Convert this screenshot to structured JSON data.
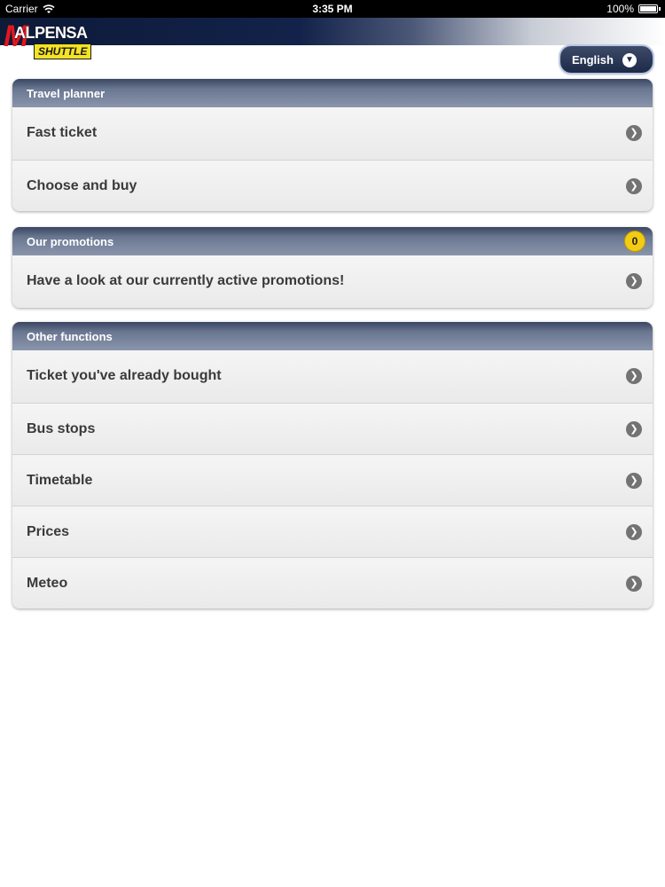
{
  "statusbar": {
    "carrier": "Carrier",
    "time": "3:35 PM",
    "battery": "100%"
  },
  "header": {
    "logo_text": "MALPENSA SHUTTLE"
  },
  "language": {
    "selected": "English"
  },
  "groups": [
    {
      "title": "Travel planner",
      "items": [
        {
          "label": "Fast ticket"
        },
        {
          "label": "Choose and buy"
        }
      ]
    },
    {
      "title": "Our promotions",
      "badge": "0",
      "items": [
        {
          "label": "Have a look at our currently active promotions!"
        }
      ]
    },
    {
      "title": "Other functions",
      "items": [
        {
          "label": "Ticket you've already bought"
        },
        {
          "label": "Bus stops"
        },
        {
          "label": "Timetable"
        },
        {
          "label": "Prices"
        },
        {
          "label": "Meteo"
        }
      ]
    }
  ],
  "colors": {
    "header_dark": "#0d1a38",
    "badge": "#f2cc14",
    "logo_red": "#e2171d",
    "logo_yellow": "#f4e324"
  }
}
